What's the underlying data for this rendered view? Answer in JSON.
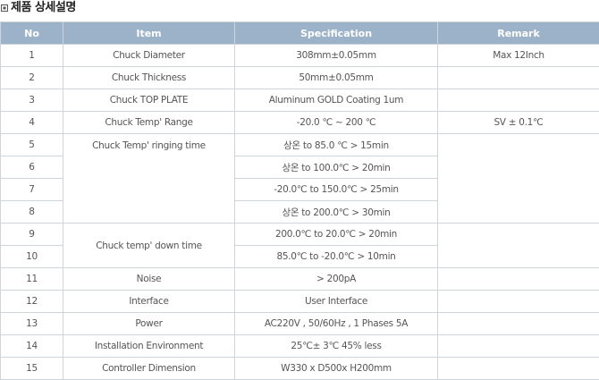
{
  "page_title": "제품 상세설명",
  "table": {
    "headers": [
      "No",
      "Item",
      "Specification",
      "Remark"
    ],
    "rows": [
      {
        "no": "1",
        "item": "Chuck Diameter",
        "spec": "308mm±0.05mm",
        "remark": "Max 12Inch"
      },
      {
        "no": "2",
        "item": "Chuck Thickness",
        "spec": "50mm±0.05mm",
        "remark": ""
      },
      {
        "no": "3",
        "item": "Chuck TOP PLATE",
        "spec": "Aluminum GOLD Coating 1um",
        "remark": ""
      },
      {
        "no": "4",
        "item": "Chuck Temp' Range",
        "spec": "-20.0 ℃ ~ 200 ℃",
        "remark": "SV ± 0.1℃"
      },
      {
        "no": "5",
        "item": "Chuck Temp' ringing time",
        "spec": "상온 to 85.0 ℃ > 15min",
        "remark": ""
      },
      {
        "no": "6",
        "item": "",
        "spec": "상온 to 100.0℃ > 20min",
        "remark": ""
      },
      {
        "no": "7",
        "item": "",
        "spec": "-20.0℃ to 150.0℃ > 25min",
        "remark": ""
      },
      {
        "no": "8",
        "item": "",
        "spec": "상온 to 200.0℃ > 30min",
        "remark": ""
      },
      {
        "no": "9",
        "item": "Chuck temp' down time",
        "spec": "200.0℃ to 20.0℃ > 20min",
        "remark": ""
      },
      {
        "no": "10",
        "item": "",
        "spec": "85.0℃ to -20.0℃ > 10min",
        "remark": ""
      },
      {
        "no": "11",
        "item": "Noise",
        "spec": "> 200pA",
        "remark": ""
      },
      {
        "no": "12",
        "item": "Interface",
        "spec": "User Interface",
        "remark": ""
      },
      {
        "no": "13",
        "item": "Power",
        "spec": "AC220V , 50/60Hz , 1 Phases 5A",
        "remark": ""
      },
      {
        "no": "14",
        "item": "Installation Environment",
        "spec": "25℃± 3℃  45%  less",
        "remark": ""
      },
      {
        "no": "15",
        "item": "Controller Dimension",
        "spec": "W330 x D500x H200mm",
        "remark": ""
      }
    ]
  },
  "colors": {
    "header_bg": "#9cb2c9",
    "highlight": "#f5a000",
    "border": "#cfd4d8"
  }
}
